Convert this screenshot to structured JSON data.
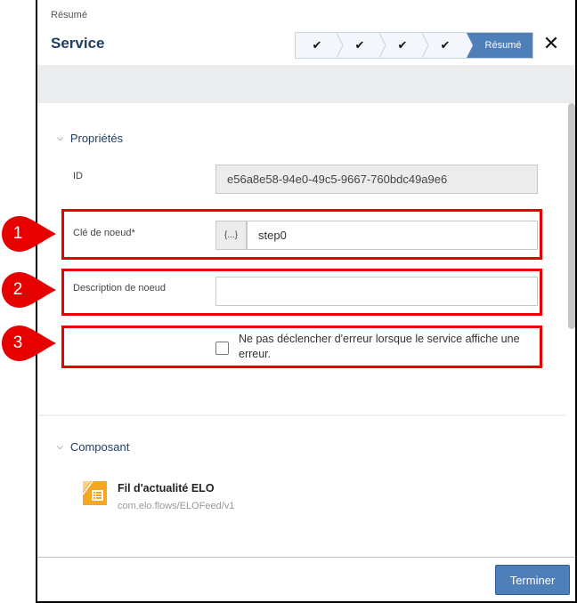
{
  "header": {
    "breadcrumb": "Résumé",
    "title": "Service",
    "steps": [
      {
        "icon": "check-icon",
        "glyph": "✔",
        "state": "done"
      },
      {
        "icon": "check-icon",
        "glyph": "✔",
        "state": "done"
      },
      {
        "icon": "check-icon",
        "glyph": "✔",
        "state": "done"
      },
      {
        "icon": "check-icon",
        "glyph": "✔",
        "state": "done"
      },
      {
        "label": "Résumé",
        "state": "active"
      }
    ],
    "close_glyph": "✕"
  },
  "properties": {
    "section_label": "Propriétés",
    "chevron_glyph": "⌄",
    "id_label": "ID",
    "id_value": "e56a8e58-94e0-49c5-9667-760bdc49a9e6",
    "node_key_label": "Clé de noeud*",
    "expression_button": "{...}",
    "node_key_value": "step0",
    "node_description_label": "Description de noeud",
    "node_description_value": "",
    "no_error_checkbox_label": "Ne pas déclencher d'erreur lorsque le service affiche une erreur.",
    "no_error_checked": false
  },
  "component": {
    "section_label": "Composant",
    "name": "Fil d'actualité ELO",
    "identifier": "com.elo.flows/ELOFeed/v1",
    "icon_color": "#f5a623"
  },
  "footer": {
    "finish_label": "Terminer"
  },
  "annotations": {
    "markers": [
      "1",
      "2",
      "3"
    ],
    "color": "#e60000"
  }
}
